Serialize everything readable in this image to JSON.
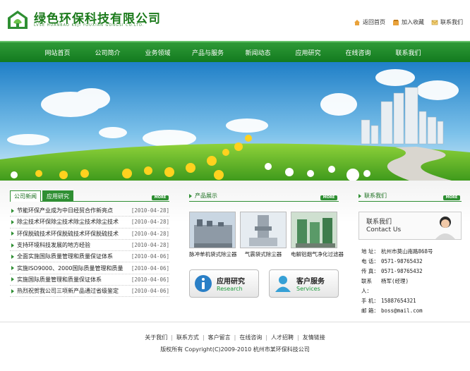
{
  "brand": {
    "name": "绿色环保科技有限公司",
    "sub": "LVSE HUANBAO KEJI YOUXIAN GONGSI CO.LTD.",
    "accent": "#2f8f33"
  },
  "toplinks": [
    {
      "label": "返回首页",
      "icon": "home-icon"
    },
    {
      "label": "加入收藏",
      "icon": "bookmark-icon"
    },
    {
      "label": "联系我们",
      "icon": "mail-icon"
    }
  ],
  "nav": [
    "网站首页",
    "公司简介",
    "业务领域",
    "产品与服务",
    "新闻动态",
    "应用研究",
    "在线咨询",
    "联系我们"
  ],
  "news": {
    "tabs": [
      "公司新闻",
      "应用研究"
    ],
    "more": "MORE",
    "items": [
      {
        "title": "节能环保产业成为中日经贸合作新亮点",
        "date": "[2010-04-28]"
      },
      {
        "title": "除尘技术环保除尘技术除尘技术除尘技术",
        "date": "[2010-04-28]"
      },
      {
        "title": "环保脱硫技术环保脱硫技术环保脱硫技术",
        "date": "[2010-04-28]"
      },
      {
        "title": "支持环境科技发展的地方经验",
        "date": "[2010-04-28]"
      },
      {
        "title": "全面实施国际质量管理和质量保证体系",
        "date": "[2010-04-06]"
      },
      {
        "title": "实施ISO9000、2000国际质量管理和质量",
        "date": "[2010-04-06]"
      },
      {
        "title": "实施国际质量管理和质量保证体系",
        "date": "[2010-04-06]"
      },
      {
        "title": "热烈祝贺我公司三项新产品通过省级鉴定",
        "date": "[2010-04-06]"
      }
    ]
  },
  "products": {
    "title": "产品展示",
    "more": "MORE",
    "items": [
      {
        "label": "脉冲单机袋式除尘器"
      },
      {
        "label": "气震袋式除尘器"
      },
      {
        "label": "电解铝烟气净化过滤器"
      }
    ],
    "buttons": [
      {
        "zh": "应用研究",
        "en": "Research",
        "icon": "info-icon"
      },
      {
        "zh": "客户服务",
        "en": "Services",
        "icon": "user-icon"
      }
    ]
  },
  "contact": {
    "title": "联系我们",
    "more": "MORE",
    "card_zh": "联系我们",
    "card_en": "Contact Us",
    "rows": [
      {
        "k": "地 址：",
        "v": "杭州市莫山南路868号"
      },
      {
        "k": "电 话：",
        "v": "0571-98765432"
      },
      {
        "k": "传 真：",
        "v": "0571-98765432"
      },
      {
        "k": "联系人：",
        "v": "杨军(经理)"
      },
      {
        "k": "手 机：",
        "v": "15887654321"
      },
      {
        "k": "邮 箱：",
        "v": "boss@mail.com"
      }
    ]
  },
  "footer": {
    "links": [
      "关于我们",
      "联系方式",
      "客户留言",
      "在线咨询",
      "人才招聘",
      "友情链接"
    ],
    "copyright": "版权所有 Copyright(C)2009-2010 杭州市某环保科技公司"
  }
}
